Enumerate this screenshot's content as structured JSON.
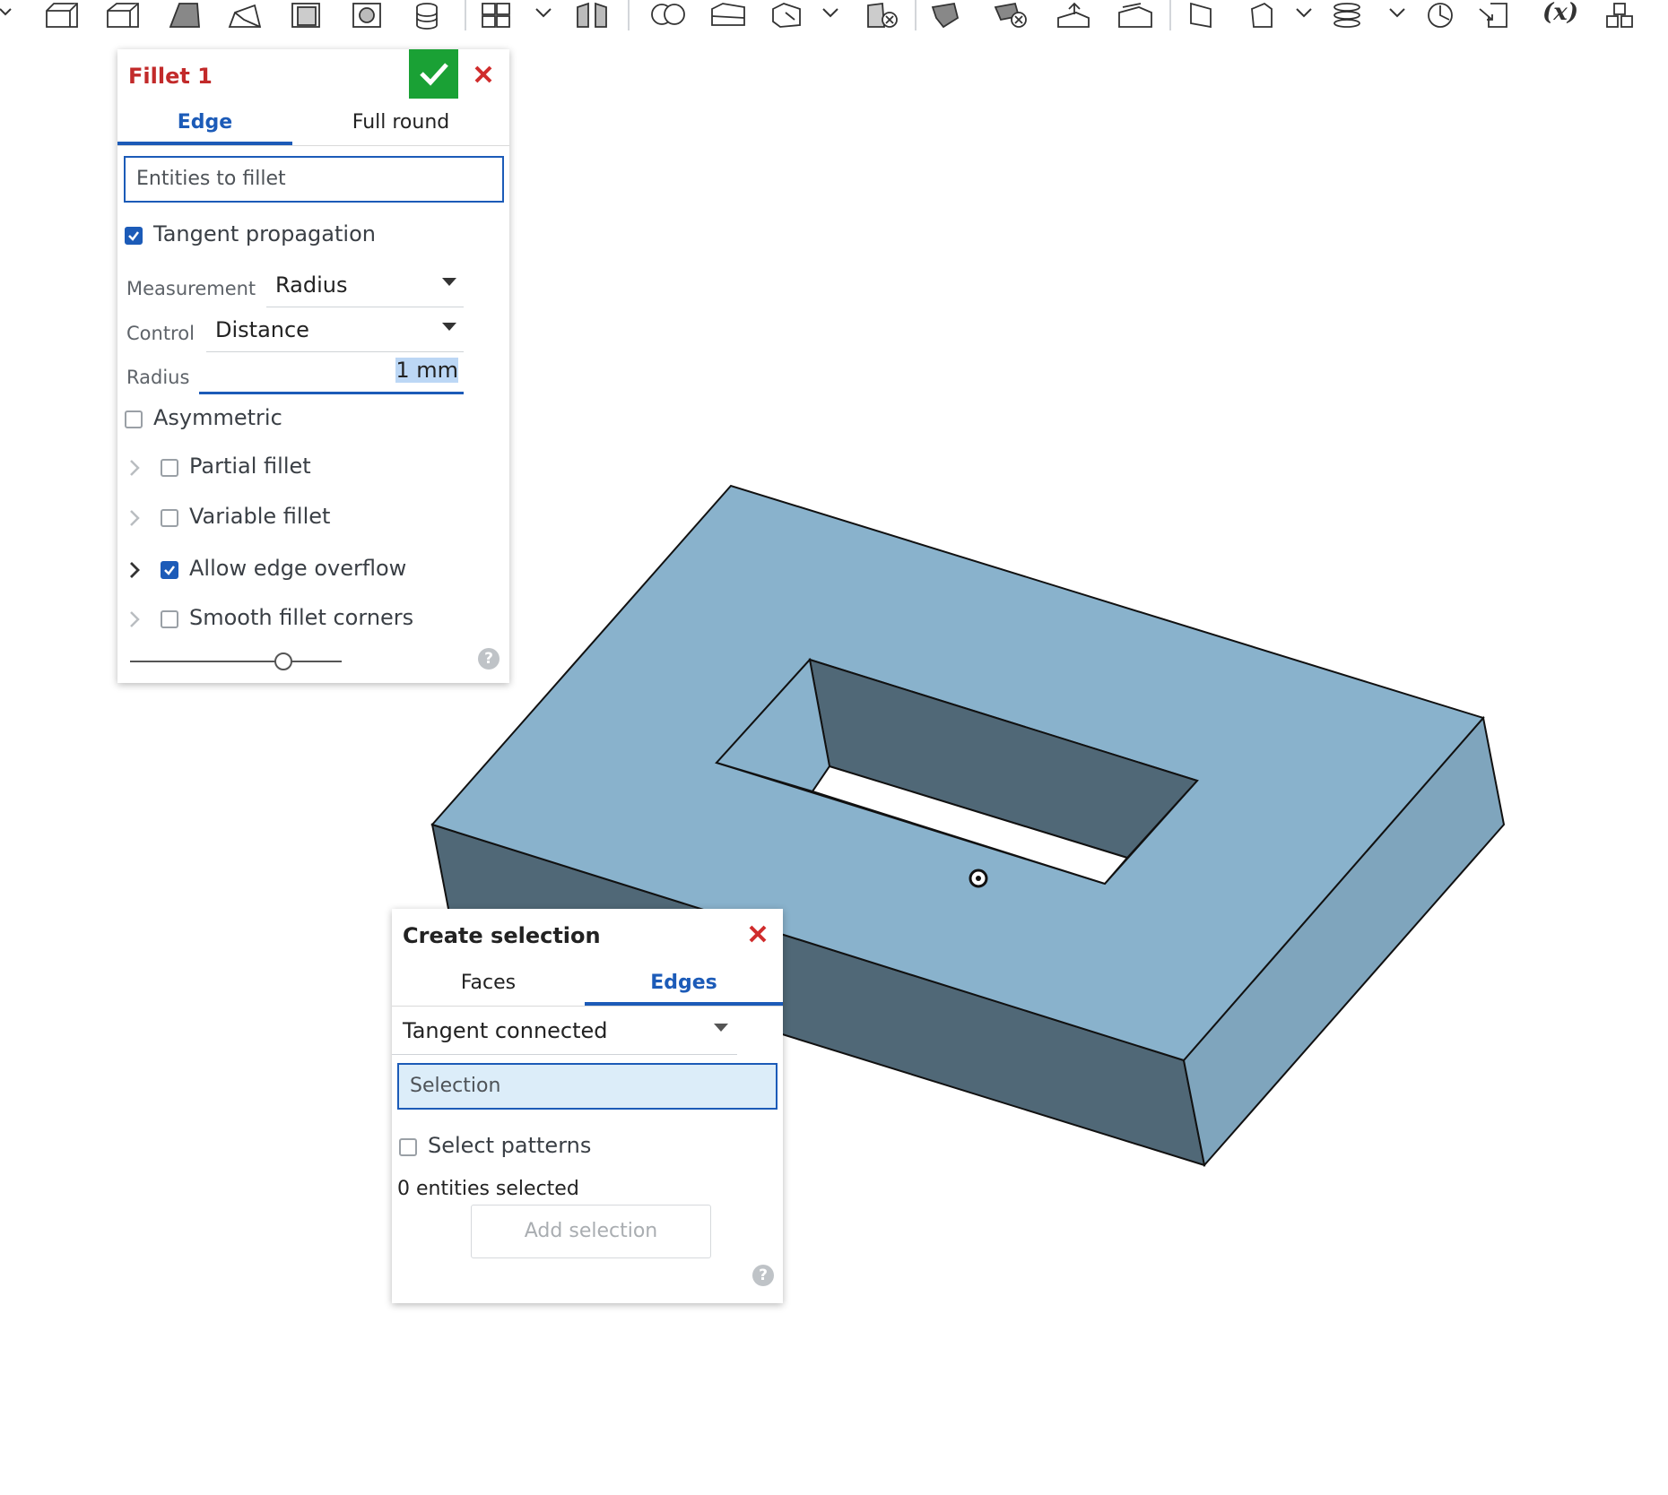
{
  "toolbar": {
    "icons": [
      "extrude-icon",
      "revolve-icon",
      "sweep-icon",
      "loft-icon",
      "thicken-icon",
      "fillet-icon",
      "chamfer-icon",
      "draft-icon",
      "rib-icon",
      "shell-icon",
      "hole-icon",
      "pattern-icon",
      "mirror-icon",
      "boolean-icon",
      "split-icon",
      "transform-icon",
      "delete-part-icon",
      "modify-fillet-icon",
      "delete-face-icon",
      "move-face-icon",
      "replace-face-icon",
      "offset-surface-icon",
      "plane-icon",
      "helix-icon",
      "mate-connector-icon",
      "variable-icon",
      "derived-icon"
    ],
    "variable_symbol": "(x)"
  },
  "fillet_panel": {
    "title": "Fillet 1",
    "tabs": [
      "Edge",
      "Full round"
    ],
    "active_tab": "Edge",
    "entities_placeholder": "Entities to fillet",
    "tangent_propagation": {
      "label": "Tangent propagation",
      "checked": true
    },
    "measurement": {
      "label": "Measurement",
      "value": "Radius"
    },
    "control": {
      "label": "Control",
      "value": "Distance"
    },
    "radius": {
      "label": "Radius",
      "value": "1 mm"
    },
    "asymmetric": {
      "label": "Asymmetric",
      "checked": false
    },
    "options": [
      {
        "label": "Partial fillet",
        "checked": false
      },
      {
        "label": "Variable fillet",
        "checked": false
      },
      {
        "label": "Allow edge overflow",
        "checked": true
      },
      {
        "label": "Smooth fillet corners",
        "checked": false
      }
    ],
    "help": "?"
  },
  "create_selection_panel": {
    "title": "Create selection",
    "tabs": [
      "Faces",
      "Edges"
    ],
    "active_tab": "Edges",
    "mode": "Tangent connected",
    "selection_placeholder": "Selection",
    "select_patterns": {
      "label": "Select patterns",
      "checked": false
    },
    "status": "0 entities selected",
    "add_button": "Add selection",
    "help": "?"
  },
  "model": {
    "top_face_color": "#89b2cc",
    "side_face_dark": "#506877",
    "side_face_right": "#7fa5bd",
    "edge_color": "#111111"
  },
  "colors": {
    "accent_blue": "#1c5bb8",
    "confirm_green": "#1aa135",
    "cancel_red": "#d02c2c",
    "title_red": "#c22a2a"
  }
}
